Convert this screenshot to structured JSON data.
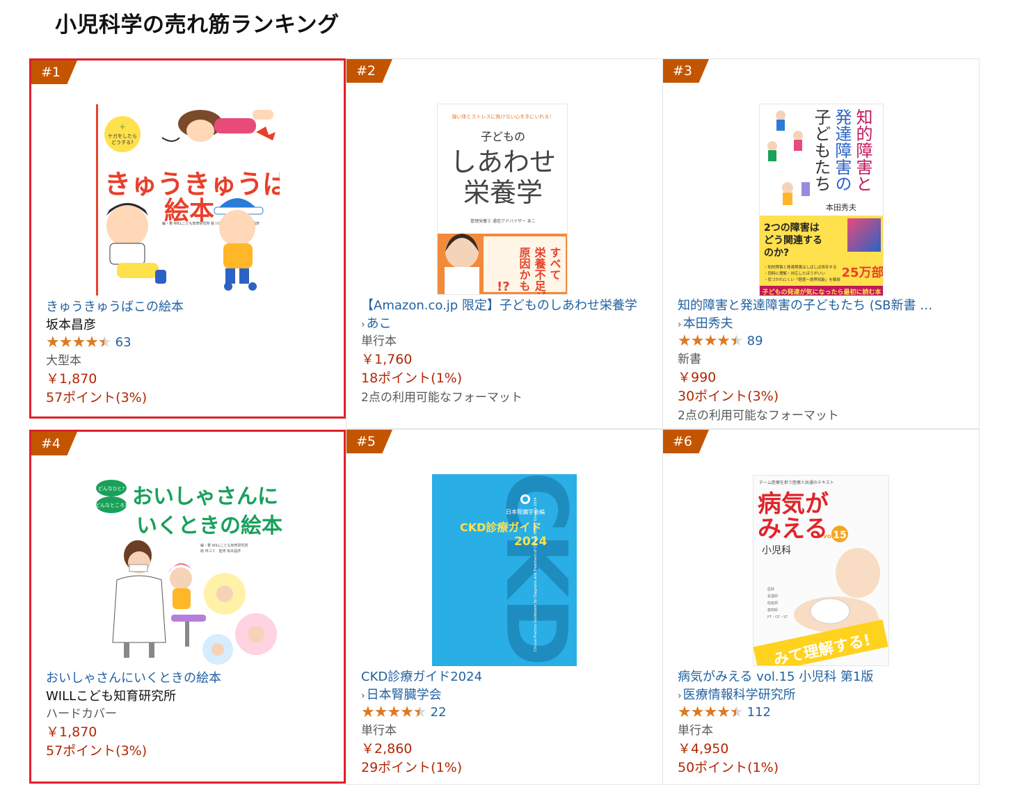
{
  "page": {
    "title": "小児科学の売れ筋ランキング"
  },
  "products": [
    {
      "rank": "#1",
      "title": "きゅうきゅうばこの絵本",
      "author": "坂本昌彦",
      "author_link": false,
      "rating": 4.5,
      "review_count": "63",
      "format": "大型本",
      "price": "￥1,870",
      "points": "57ポイント(3%)",
      "other_formats": "",
      "cover": {
        "badge": "ケガをしたら どうする?",
        "title_line1": "きゅうきゅうばこの",
        "title_line2": "絵本",
        "credits": "編・著 WILLこども知育研究所 / 絵 川添健久 / 監修責任 坂本昌彦",
        "accent": "#e8402b"
      }
    },
    {
      "rank": "#2",
      "title": "【Amazon.co.jp 限定】子どものしあわせ栄養学",
      "author": "あこ",
      "author_link": true,
      "rating": null,
      "review_count": "",
      "format": "単行本",
      "price": "￥1,760",
      "points": "18ポイント(1%)",
      "other_formats": "2点の利用可能なフォーマット",
      "cover": {
        "tagline": "強い体とストレスに負けない心を手にいれる！",
        "title_small": "子どもの",
        "title_line1": "しあわせ",
        "title_line2": "栄養学",
        "author_line": "管理栄養士 通信アドバイザー あこ",
        "band1": "すべて",
        "band2": "栄養不足が",
        "band3": "原因かも",
        "accent": "#f28a3c"
      }
    },
    {
      "rank": "#3",
      "title": "知的障害と発達障害の子どもたち (SB新書 …",
      "author": "本田秀夫",
      "author_link": true,
      "rating": 4.5,
      "review_count": "89",
      "format": "新書",
      "price": "￥990",
      "points": "30ポイント(3%)",
      "other_formats": "2点の利用可能なフォーマット",
      "cover": {
        "title_col1": "知的障害と",
        "title_col2": "発達障害の",
        "title_col3": "子どもたち",
        "author": "本田秀夫",
        "question": "2つの障害はどう関連するのか？",
        "bottom": "子どもの発達が気になったら最初に読む本",
        "seal": "25万部",
        "accent": "#c2185b"
      }
    },
    {
      "rank": "#4",
      "title": "おいしゃさんにいくときの絵本",
      "author": "WILLこども知育研究所",
      "author_link": false,
      "rating": null,
      "review_count": "",
      "format": "ハードカバー",
      "price": "￥1,870",
      "points": "57ポイント(3%)",
      "other_formats": "",
      "cover": {
        "badge1": "どんなひと?",
        "badge2": "どんなところ?",
        "title_line1": "おいしゃさんに",
        "title_line2": "いくときの絵本",
        "credits": "編・著 WILLこども知育研究所 / 絵 林ユミ / 監修 坂本昌彦",
        "accent": "#19a05a"
      }
    },
    {
      "rank": "#5",
      "title": "CKD診療ガイド2024",
      "author": "日本腎臓学会",
      "author_link": true,
      "rating": 4.5,
      "review_count": "22",
      "format": "単行本",
      "price": "￥2,860",
      "points": "29ポイント(1%)",
      "other_formats": "",
      "cover": {
        "publisher_line": "日本腎臓学会編",
        "title": "CKD診療ガイド",
        "year": "2024",
        "big_letters": "CKD",
        "accent": "#29aee6"
      }
    },
    {
      "rank": "#6",
      "title": "病気がみえる vol.15 小児科 第1版",
      "author": "医療情報科学研究所",
      "author_link": true,
      "rating": 4.5,
      "review_count": "112",
      "format": "単行本",
      "price": "￥4,950",
      "points": "50ポイント(1%)",
      "other_formats": "",
      "cover": {
        "top": "チーム医療を担う医療人共通のテキスト",
        "title_line1": "病気が",
        "title_line2": "みえる",
        "vol": "15",
        "subject": "小児科",
        "banner": "みて理解する!",
        "accent": "#e0252b"
      }
    }
  ]
}
